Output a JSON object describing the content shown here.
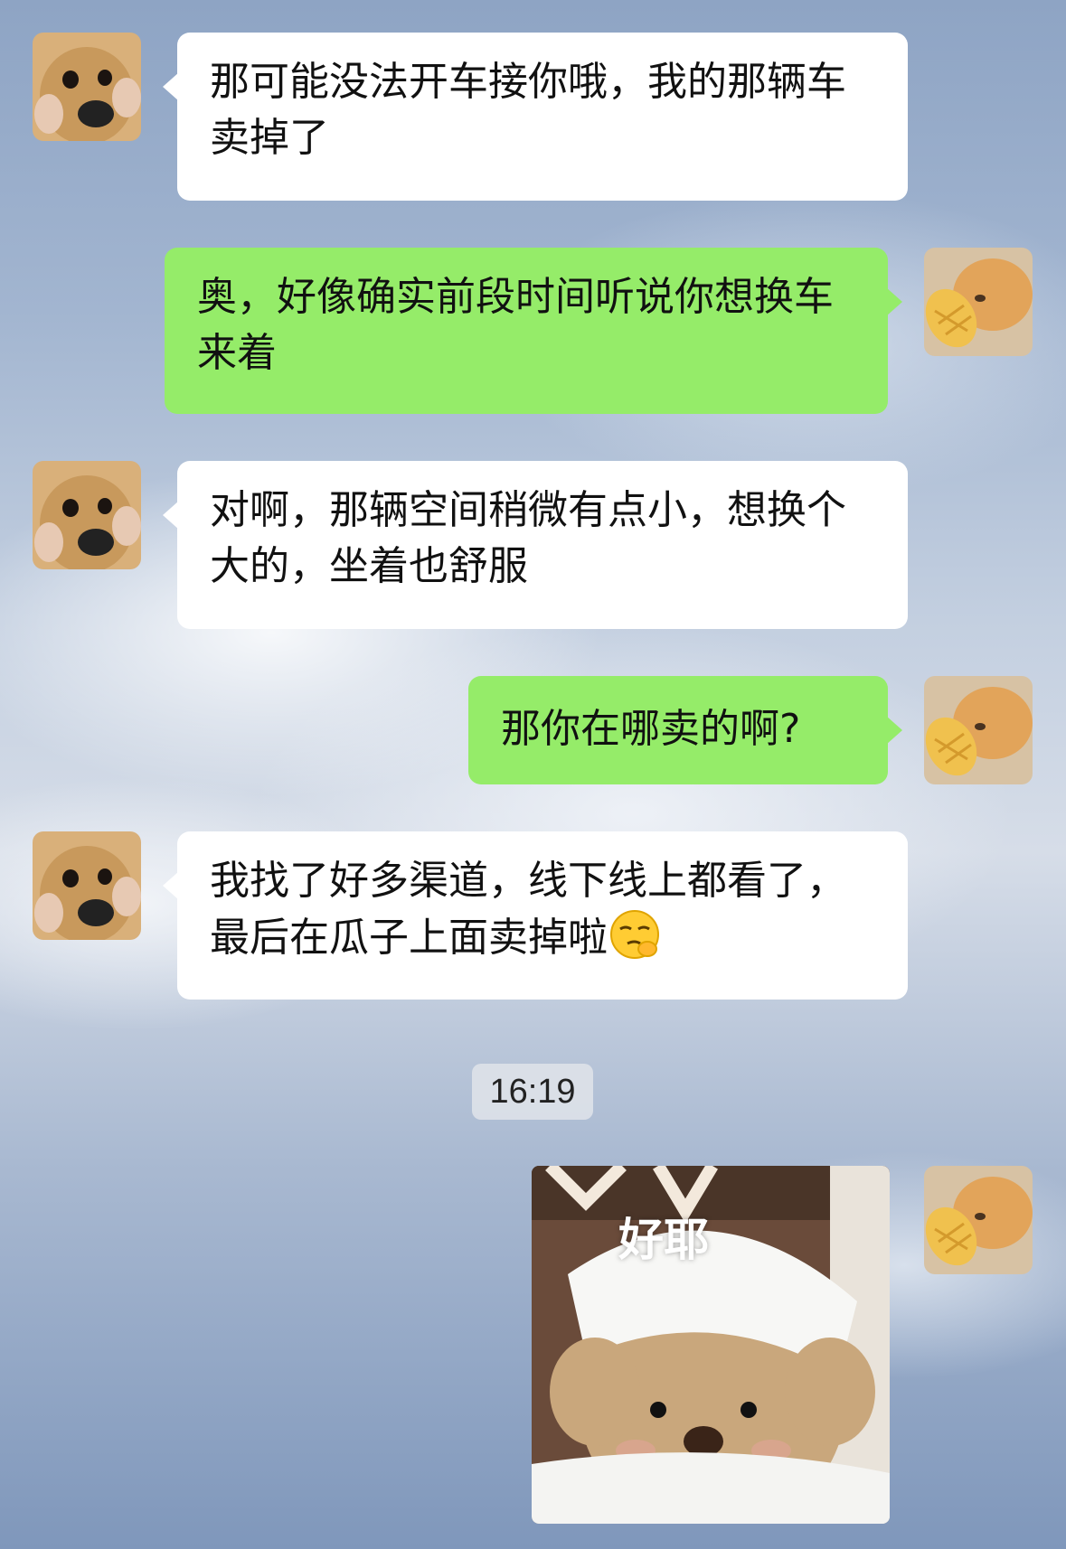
{
  "messages": [
    {
      "side": "left",
      "text": "那可能没法开车接你哦，我的那辆车卖掉了",
      "avatar": "dog-avatar"
    },
    {
      "side": "right",
      "text": "奥，好像确实前段时间听说你想换车来着",
      "avatar": "cat-avatar"
    },
    {
      "side": "left",
      "text": "对啊，那辆空间稍微有点小，想换个大的，坐着也舒服",
      "avatar": "dog-avatar"
    },
    {
      "side": "right",
      "text": "那你在哪卖的啊?",
      "avatar": "cat-avatar"
    },
    {
      "side": "left",
      "text": "我找了好多渠道，线下线上都看了，最后在瓜子上面卖掉啦",
      "avatar": "dog-avatar",
      "trailing_emoji": "smirk-shush-emoji"
    }
  ],
  "timestamp": "16:19",
  "sticker": {
    "caption": "好耶",
    "avatar": "cat-avatar"
  },
  "colors": {
    "bubble_self": "#95ec69",
    "bubble_other": "#ffffff"
  }
}
